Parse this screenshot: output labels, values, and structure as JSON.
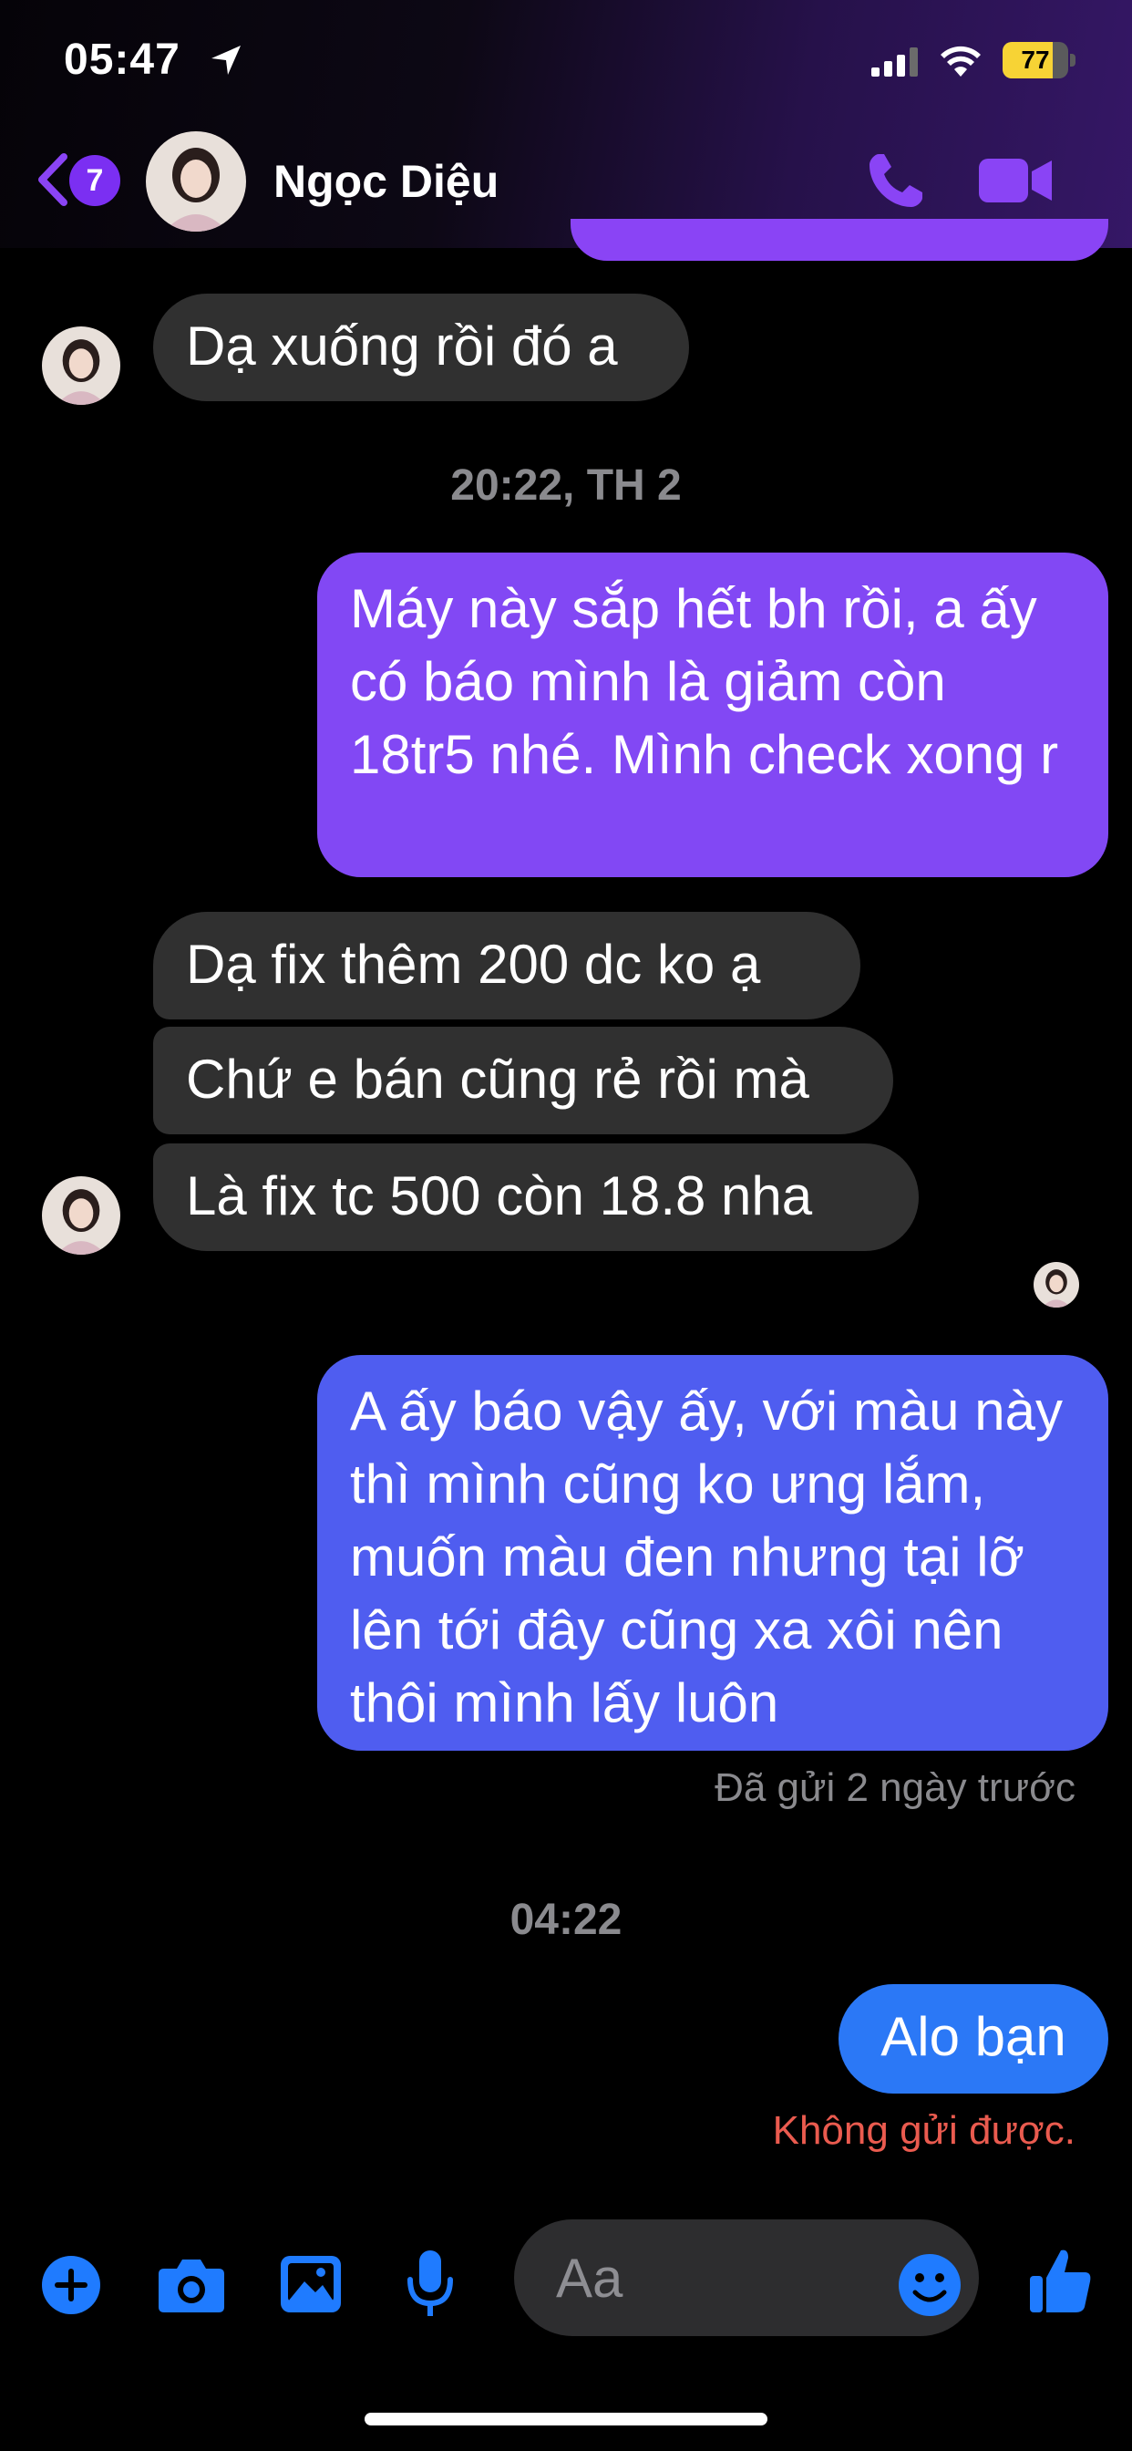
{
  "status_bar": {
    "time": "05:47",
    "battery": "77",
    "battery_level": 0.77
  },
  "header": {
    "back_badge": "7",
    "contact_name": "Ngọc Diệu",
    "accent_color": "#8a44f5"
  },
  "messages": {
    "incoming_1": "Dạ xuống rồi đó a",
    "timestamp_1": "20:22, TH 2",
    "outgoing_1": "Máy này sắp hết bh rồi, a ấy có báo mình là giảm còn 18tr5 nhé. Mình check xong r",
    "incoming_2": "Dạ fix thêm 200 dc ko ạ",
    "incoming_3": "Chứ e bán cũng rẻ rồi mà",
    "incoming_4": "Là fix tc 500 còn 18.8 nha",
    "outgoing_2": "A ấy báo vậy ấy, với màu này thì mình cũng ko ưng lắm, muốn màu đen nhưng tại lỡ lên tới đây cũng xa xôi nên thôi mình lấy luôn",
    "sent_status": "Đã gửi 2 ngày trước",
    "timestamp_2": "04:22",
    "outgoing_3": "Alo bạn",
    "error_status": "Không gửi được."
  },
  "composer": {
    "placeholder": "Aa",
    "icon_color": "#1f7bff"
  },
  "icons": [
    "location-arrow-icon",
    "signal-icon",
    "wifi-icon",
    "battery-icon",
    "back-chevron-icon",
    "phone-icon",
    "video-camera-icon",
    "plus-icon",
    "camera-icon",
    "image-icon",
    "microphone-icon",
    "emoji-icon",
    "thumbs-up-icon"
  ]
}
